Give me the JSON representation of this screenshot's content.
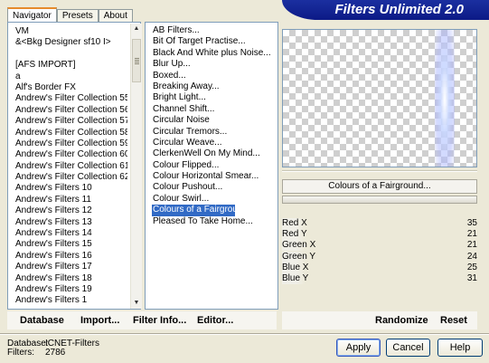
{
  "tabs": [
    "Navigator",
    "Presets",
    "About"
  ],
  "banner_title": "Filters Unlimited 2.0",
  "categories": [
    "VM",
    "&<Bkg Designer sf10 I>",
    "",
    "[AFS IMPORT]",
    "a",
    "Alf's Border FX",
    "Andrew's Filter Collection 55",
    "Andrew's Filter Collection 56",
    "Andrew's Filter Collection 57",
    "Andrew's Filter Collection 58",
    "Andrew's Filter Collection 59",
    "Andrew's Filter Collection 60",
    "Andrew's Filter Collection 61",
    "Andrew's Filter Collection 62",
    "Andrew's Filters 10",
    "Andrew's Filters 11",
    "Andrew's Filters 12",
    "Andrew's Filters 13",
    "Andrew's Filters 14",
    "Andrew's Filters 15",
    "Andrew's Filters 16",
    "Andrew's Filters 17",
    "Andrew's Filters 18",
    "Andrew's Filters 19",
    "Andrew's Filters 1"
  ],
  "filters": [
    "AB Filters...",
    "Bit Of Target Practise...",
    "Black And White plus Noise...",
    "Blur Up...",
    "Boxed...",
    "Breaking Away...",
    "Bright Light...",
    "Channel Shift...",
    "Circular Noise",
    "Circular Tremors...",
    "Circular Weave...",
    "ClerkenWell On My Mind...",
    "Colour Flipped...",
    "Colour Horizontal Smear...",
    "Colour Pushout...",
    "Colour Swirl...",
    "Colours of a Fairground...",
    "Pleased To Take Home..."
  ],
  "selected_filter_index": 16,
  "current_filter_name": "Colours of a Fairground...",
  "parameters": [
    {
      "label": "Red X",
      "value": "35"
    },
    {
      "label": "Red Y",
      "value": "21"
    },
    {
      "label": "Green X",
      "value": "21"
    },
    {
      "label": "Green Y",
      "value": "24"
    },
    {
      "label": "Blue X",
      "value": "25"
    },
    {
      "label": "Blue Y",
      "value": "31"
    }
  ],
  "left_buttons": [
    "Database",
    "Import...",
    "Filter Info...",
    "Editor..."
  ],
  "right_buttons": [
    "Randomize",
    "Reset"
  ],
  "db_info": {
    "database_label": "Database:",
    "database_value": "ICNET-Filters",
    "filters_label": "Filters:",
    "filters_value": "2786"
  },
  "dialog_buttons": {
    "apply": "Apply",
    "cancel": "Cancel",
    "help": "Help"
  },
  "colors": {
    "selection": "#316ac5",
    "banner": "#0c1a86",
    "active_tab_accent": "#e68b2c"
  }
}
